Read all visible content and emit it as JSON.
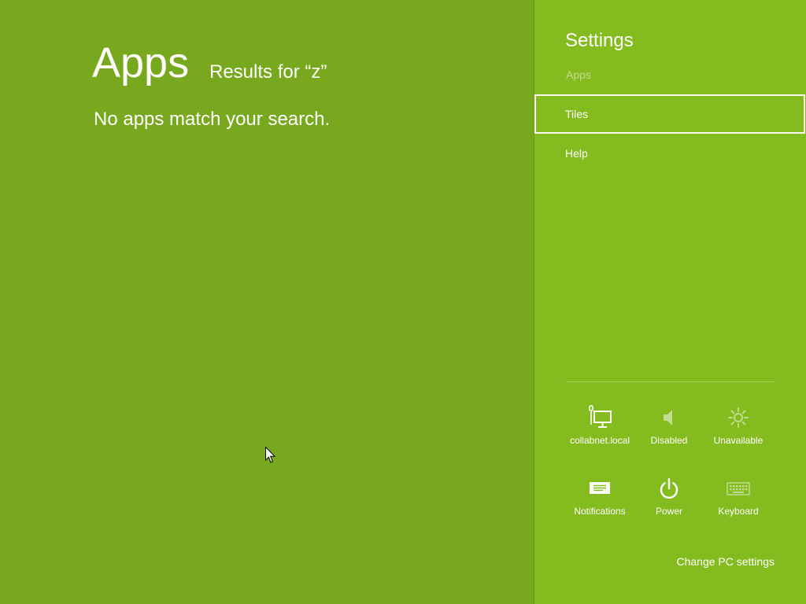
{
  "search": {
    "title": "Apps",
    "results_for": "Results for “z”",
    "no_results": "No apps match your search."
  },
  "settings": {
    "title": "Settings",
    "app_name": "Apps",
    "commands": [
      {
        "label": "Tiles",
        "focused": true
      },
      {
        "label": "Help",
        "focused": false
      }
    ],
    "quick_actions": [
      {
        "icon": "network-icon",
        "label": "collabnet.local",
        "enabled": true
      },
      {
        "icon": "volume-icon",
        "label": "Disabled",
        "enabled": false
      },
      {
        "icon": "brightness-icon",
        "label": "Unavailable",
        "enabled": false
      },
      {
        "icon": "notifications-icon",
        "label": "Notifications",
        "enabled": true
      },
      {
        "icon": "power-icon",
        "label": "Power",
        "enabled": true
      },
      {
        "icon": "keyboard-icon",
        "label": "Keyboard",
        "enabled": false
      }
    ],
    "change_pc_settings": "Change PC settings"
  },
  "colors": {
    "background": "#78a81e",
    "pane": "#84bb1f",
    "pane_border": "#6c9a17",
    "focus_border": "#ffffff"
  }
}
